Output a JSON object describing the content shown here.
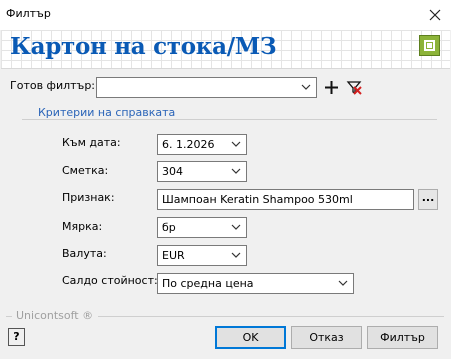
{
  "window": {
    "title": "Филтър",
    "close_label": "✕"
  },
  "header": {
    "title": "Картон на стока/МЗ",
    "logo_icon": "unicontsoft-logo-icon"
  },
  "filter_preset": {
    "label": "Готов филтър:",
    "value": ""
  },
  "group": {
    "title": "Критерии на справката"
  },
  "fields": {
    "date": {
      "label": "Към дата:",
      "value": "6.  1.2026"
    },
    "account": {
      "label": "Сметка:",
      "value": "304"
    },
    "attribute": {
      "label": "Признак:",
      "value": "Шампоан Keratin Shampoo 530ml",
      "browse_label": "..."
    },
    "unit": {
      "label": "Мярка:",
      "value": "бр"
    },
    "currency": {
      "label": "Валута:",
      "value": "EUR"
    },
    "balance_value": {
      "label": "Салдо стойност:",
      "value": "По средна цена"
    }
  },
  "footer": {
    "brand": "Unicontsoft ®",
    "help_label": "?",
    "ok_label": "OK",
    "cancel_label": "Отказ",
    "filter_label": "Филтър"
  },
  "colors": {
    "title_blue": "#0a5ab5",
    "link_blue": "#2a64b8",
    "focus_border": "#0078d7",
    "logo_green": "#8cb339"
  }
}
